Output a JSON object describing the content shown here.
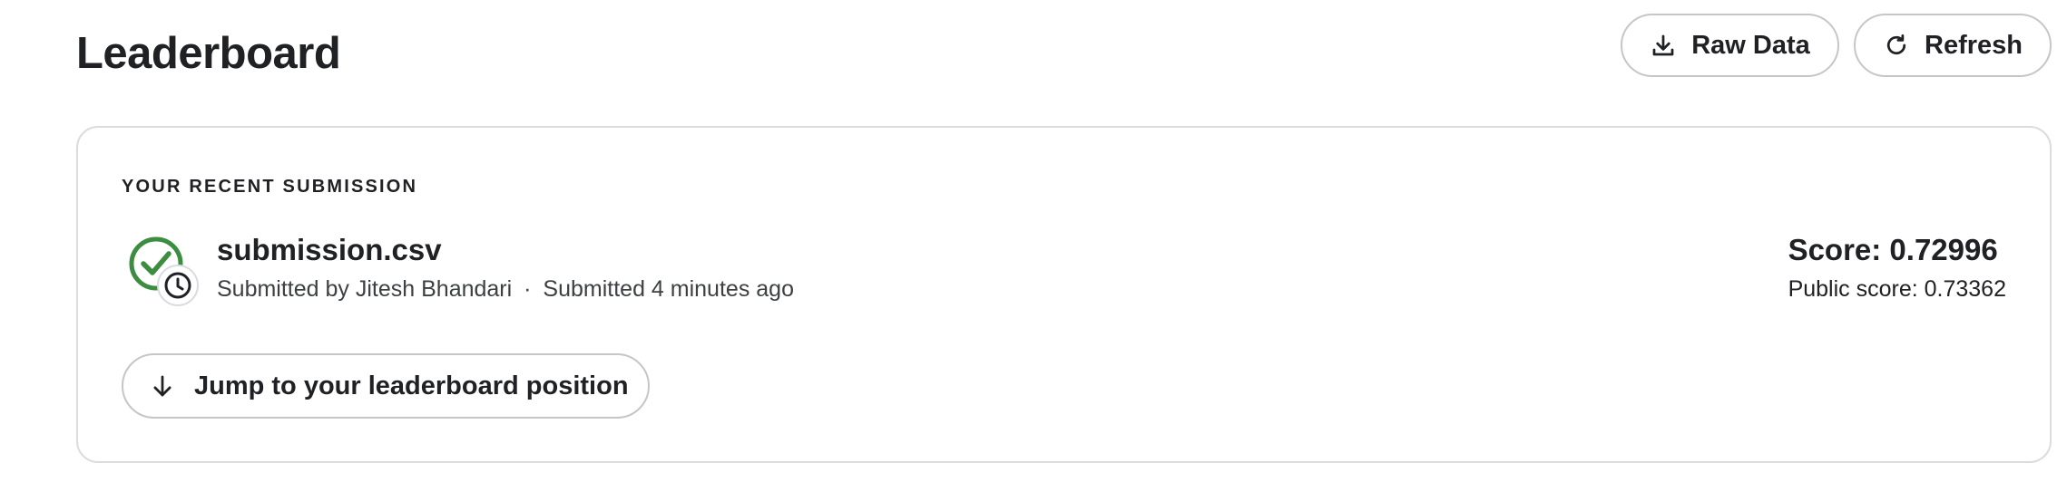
{
  "header": {
    "title": "Leaderboard",
    "raw_data_label": "Raw Data",
    "refresh_label": "Refresh"
  },
  "submission": {
    "section_label": "YOUR RECENT SUBMISSION",
    "file_name": "submission.csv",
    "submitted_by": "Submitted by Jitesh Bhandari",
    "separator": "·",
    "submitted_time": "Submitted 4 minutes ago",
    "score": "Score: 0.72996",
    "public_score": "Public score: 0.73362",
    "status_icons": [
      "check-circle-icon",
      "clock-icon"
    ],
    "jump_label": "Jump to your leaderboard position"
  },
  "colors": {
    "success": "#3c8d40",
    "text": "#202124",
    "border": "#dadce0"
  }
}
